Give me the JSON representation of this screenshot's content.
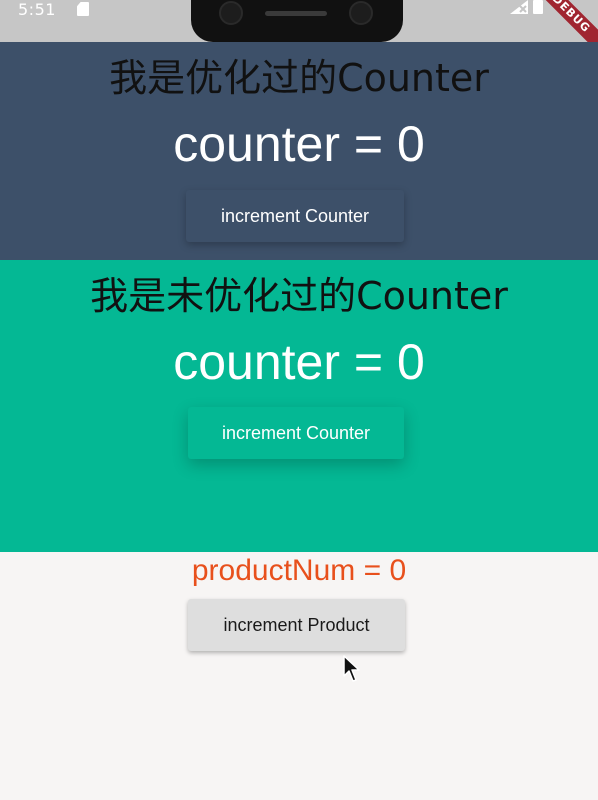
{
  "status_bar": {
    "time": "5:51",
    "debug_label": "DEBUG"
  },
  "optimized_section": {
    "title": "我是优化过的Counter",
    "counter_text": "counter = 0",
    "button_label": "increment Counter",
    "background_color": "#3d5069"
  },
  "unoptimized_section": {
    "title": "我是未优化过的Counter",
    "counter_text": "counter = 0",
    "button_label": "increment Counter",
    "background_color": "#04b894"
  },
  "product_section": {
    "product_text": "productNum = 0",
    "button_label": "increment Product",
    "text_color": "#e8501c"
  },
  "icons": {
    "sim": "sim-card-icon",
    "signal": "signal-icon",
    "battery": "battery-icon",
    "cursor": "mouse-cursor-icon"
  }
}
